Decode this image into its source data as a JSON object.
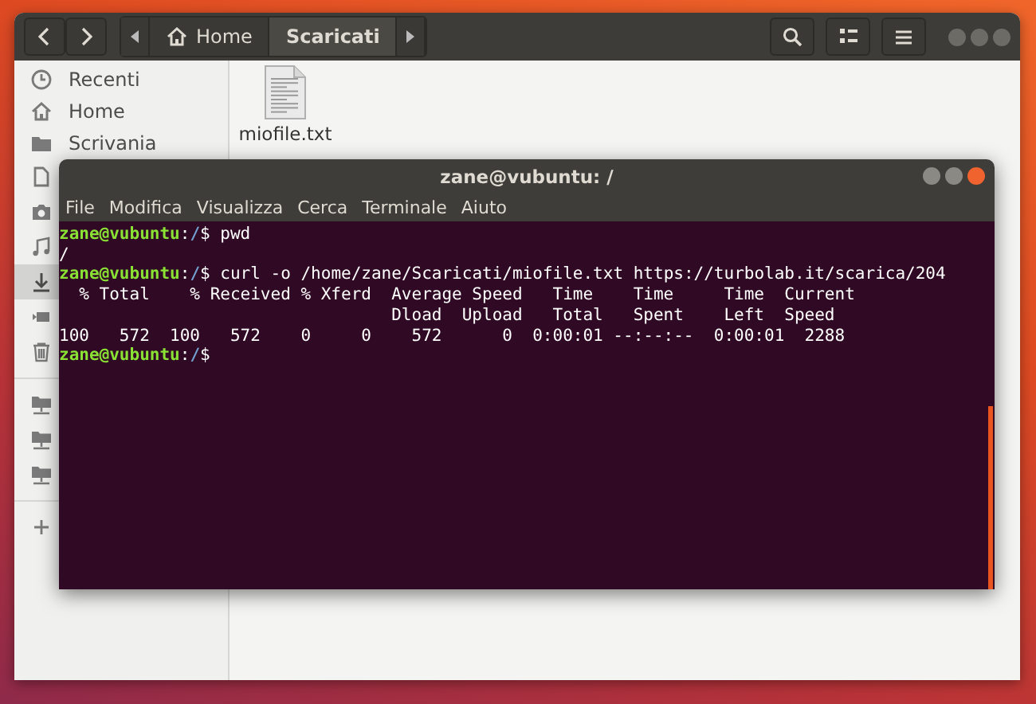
{
  "files_window": {
    "path_bar": [
      {
        "label": "Home",
        "kind": "home",
        "selected": false
      },
      {
        "label": "Scaricati",
        "kind": "folder",
        "selected": true
      }
    ],
    "sidebar": {
      "items": [
        {
          "label": "Recenti",
          "kind": "recent",
          "selected": false
        },
        {
          "label": "Home",
          "kind": "home",
          "selected": false
        },
        {
          "label": "Scrivania",
          "kind": "folder",
          "selected": false
        },
        {
          "kind": "document",
          "selected": false
        },
        {
          "kind": "camera",
          "selected": false
        },
        {
          "kind": "music",
          "selected": false
        },
        {
          "kind": "download",
          "selected": true
        },
        {
          "kind": "video",
          "selected": false
        },
        {
          "kind": "trash",
          "selected": false
        },
        {
          "kind": "separator"
        },
        {
          "kind": "network",
          "selected": false
        },
        {
          "kind": "network",
          "selected": false
        },
        {
          "kind": "network",
          "selected": false
        },
        {
          "kind": "separator"
        },
        {
          "kind": "add",
          "selected": false
        }
      ]
    },
    "files": [
      {
        "name": "miofile.txt",
        "kind": "text"
      }
    ]
  },
  "terminal": {
    "title": "zane@vubuntu: /",
    "menu": [
      "File",
      "Modifica",
      "Visualizza",
      "Cerca",
      "Terminale",
      "Aiuto"
    ],
    "lines": [
      {
        "kind": "prompt",
        "user": "zane@vubuntu",
        "colon": ":",
        "path": "/",
        "sigil": "$",
        "command": "pwd"
      },
      {
        "kind": "output",
        "text": "/"
      },
      {
        "kind": "prompt",
        "user": "zane@vubuntu",
        "colon": ":",
        "path": "/",
        "sigil": "$",
        "command": "curl -o /home/zane/Scaricati/miofile.txt https://turbolab.it/scarica/204"
      },
      {
        "kind": "output",
        "text": "  % Total    % Received % Xferd  Average Speed   Time    Time     Time  Current"
      },
      {
        "kind": "output",
        "text": "                                 Dload  Upload   Total   Spent    Left  Speed"
      },
      {
        "kind": "output",
        "text": "100   572  100   572    0     0    572      0  0:00:01 --:--:--  0:00:01  2288"
      },
      {
        "kind": "prompt",
        "user": "zane@vubuntu",
        "colon": ":",
        "path": "/",
        "sigil": "$"
      }
    ]
  }
}
